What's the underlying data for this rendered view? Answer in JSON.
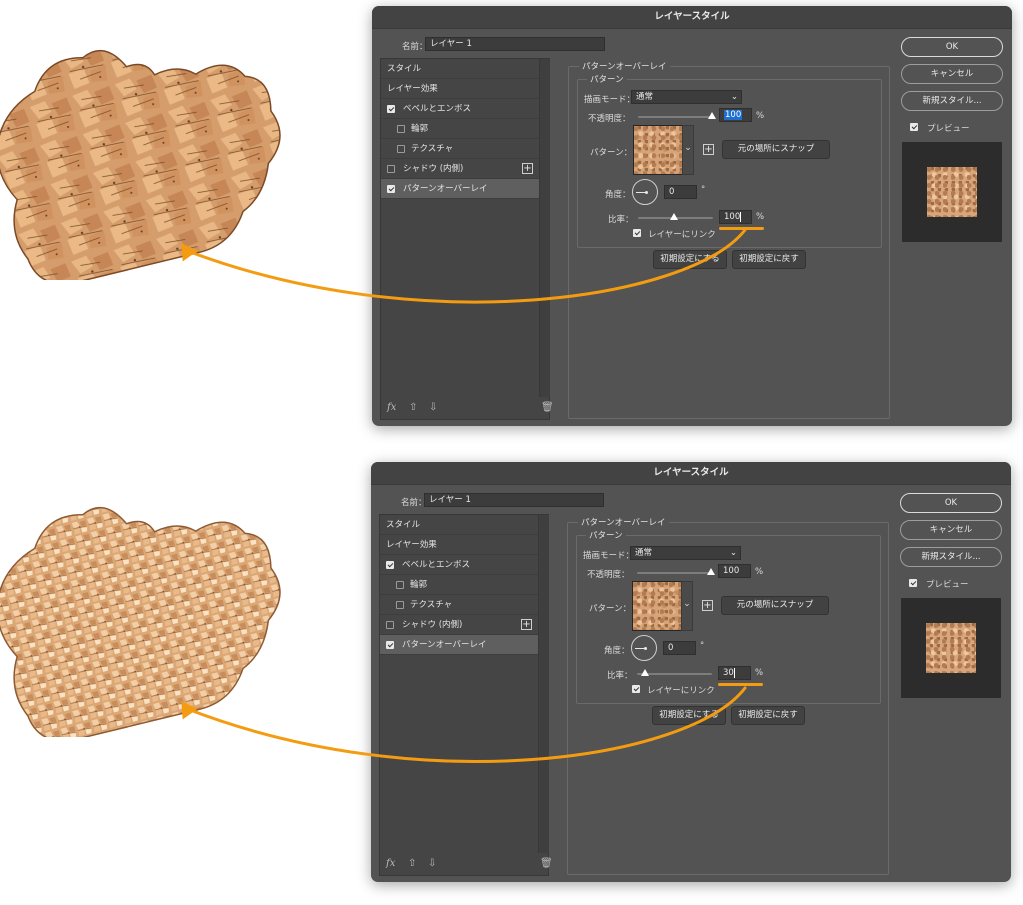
{
  "colors": {
    "arrow": "#f39c12",
    "dialog_bg": "#535353",
    "selection": "#1f6fd0"
  },
  "dialogs": [
    {
      "title": "レイヤースタイル",
      "name_label": "名前：",
      "name_value": "レイヤー 1",
      "styles": {
        "items": [
          {
            "label": "スタイル"
          },
          {
            "label": "レイヤー効果"
          },
          {
            "label": "ベベルとエンボス",
            "checked": true
          },
          {
            "label": "輪郭",
            "checked": false
          },
          {
            "label": "テクスチャ",
            "checked": false
          },
          {
            "label": "シャドウ (内側)",
            "checked": false
          },
          {
            "label": "パターンオーバーレイ",
            "checked": true,
            "active": true
          }
        ],
        "footer_fx": "fx"
      },
      "panel": {
        "group_title": "パターンオーバーレイ",
        "subgroup_title": "パターン",
        "blend_label": "描画モード：",
        "blend_value": "通常",
        "opacity_label": "不透明度：",
        "opacity_value": "100",
        "opacity_unit": "%",
        "opacity_level": 1.0,
        "pattern_label": "パターン：",
        "snap_button": "元の場所にスナップ",
        "angle_label": "角度：",
        "angle_value": "0",
        "angle_unit": "°",
        "scale_label": "比率：",
        "scale_value": "100",
        "scale_unit": "%",
        "link_label": "レイヤーにリンク",
        "link_checked": true,
        "reset_default_button": "初期設定にする",
        "restore_default_button": "初期設定に戻す"
      },
      "buttons": {
        "ok": "OK",
        "cancel": "キャンセル",
        "new_style": "新規スタイル...",
        "preview": "プレビュー",
        "preview_checked": true
      }
    },
    {
      "title": "レイヤースタイル",
      "name_label": "名前：",
      "name_value": "レイヤー 1",
      "styles": {
        "items": [
          {
            "label": "スタイル"
          },
          {
            "label": "レイヤー効果"
          },
          {
            "label": "ベベルとエンボス",
            "checked": true
          },
          {
            "label": "輪郭",
            "checked": false
          },
          {
            "label": "テクスチャ",
            "checked": false
          },
          {
            "label": "シャドウ (内側)",
            "checked": false
          },
          {
            "label": "パターンオーバーレイ",
            "checked": true,
            "active": true
          }
        ],
        "footer_fx": "fx"
      },
      "panel": {
        "group_title": "パターンオーバーレイ",
        "subgroup_title": "パターン",
        "blend_label": "描画モード：",
        "blend_value": "通常",
        "opacity_label": "不透明度：",
        "opacity_value": "100",
        "opacity_unit": "%",
        "opacity_level": 1.0,
        "pattern_label": "パターン：",
        "snap_button": "元の場所にスナップ",
        "angle_label": "角度：",
        "angle_value": "0",
        "angle_unit": "°",
        "scale_label": "比率：",
        "scale_value": "30",
        "scale_unit": "%",
        "link_label": "レイヤーにリンク",
        "link_checked": true,
        "reset_default_button": "初期設定にする",
        "restore_default_button": "初期設定に戻す"
      },
      "buttons": {
        "ok": "OK",
        "cancel": "キャンセル",
        "new_style": "新規スタイル...",
        "preview": "プレビュー",
        "preview_checked": true
      }
    }
  ]
}
